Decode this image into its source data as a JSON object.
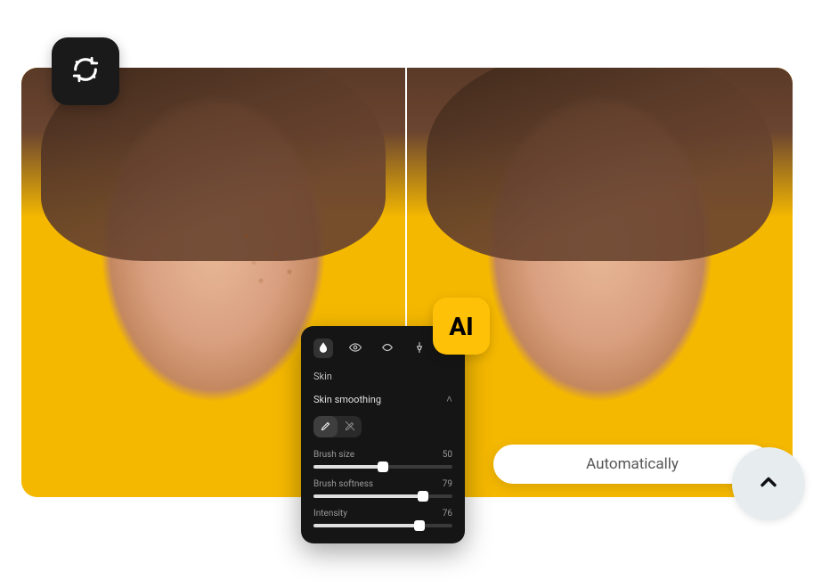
{
  "badges": {
    "ai_label": "AI",
    "sync_icon": "sync-sparkle"
  },
  "panel": {
    "tools": [
      {
        "name": "droplet-icon",
        "active": true
      },
      {
        "name": "eye-icon",
        "active": false
      },
      {
        "name": "mouth-icon",
        "active": false
      },
      {
        "name": "pin-icon",
        "active": false
      }
    ],
    "title": "Skin",
    "section_label": "Skin smoothing",
    "brush_modes": {
      "add_icon": "brush-add-icon",
      "erase_icon": "brush-erase-icon"
    },
    "sliders": [
      {
        "label": "Brush size",
        "value": 50,
        "max": 100
      },
      {
        "label": "Brush softness",
        "value": 79,
        "max": 100
      },
      {
        "label": "Intensity",
        "value": 76,
        "max": 100
      }
    ]
  },
  "auto_pill": {
    "label": "Automatically"
  },
  "compare": {
    "before_alt": "Before: original photo with skin texture",
    "after_alt": "After: AI-smoothed skin"
  }
}
